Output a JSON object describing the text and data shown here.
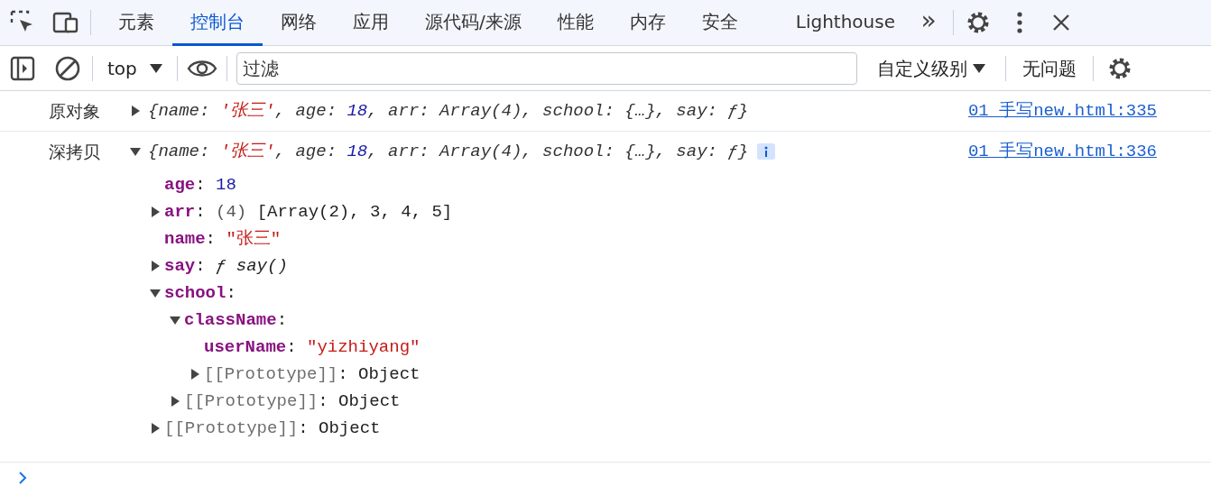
{
  "toolbar": {
    "tabs": [
      {
        "label": "元素",
        "selected": false
      },
      {
        "label": "控制台",
        "selected": true
      },
      {
        "label": "网络",
        "selected": false
      },
      {
        "label": "应用",
        "selected": false
      },
      {
        "label": "源代码/来源",
        "selected": false
      },
      {
        "label": "性能",
        "selected": false
      },
      {
        "label": "内存",
        "selected": false
      },
      {
        "label": "安全",
        "selected": false
      },
      {
        "label": "Lighthouse",
        "selected": false
      }
    ],
    "more": "»"
  },
  "console_bar": {
    "context": "top",
    "filter": {
      "placeholder": "过滤"
    },
    "levels": "自定义级别",
    "issues": "无问题"
  },
  "messages": [
    {
      "label": "原对象",
      "expanded": false,
      "info": false,
      "source": "01_手写new.html:335",
      "preview": [
        {
          "text": "{name: ",
          "kind": "plain"
        },
        {
          "text": "'张三'",
          "kind": "string"
        },
        {
          "text": ", age: ",
          "kind": "plain"
        },
        {
          "text": "18",
          "kind": "number"
        },
        {
          "text": ", arr: Array(4), school: {…}, say: ƒ}",
          "kind": "plain"
        }
      ]
    },
    {
      "label": "深拷贝",
      "expanded": true,
      "info": true,
      "source": "01_手写new.html:336",
      "preview": [
        {
          "text": "{name: ",
          "kind": "plain"
        },
        {
          "text": "'张三'",
          "kind": "string"
        },
        {
          "text": ", age: ",
          "kind": "plain"
        },
        {
          "text": "18",
          "kind": "number"
        },
        {
          "text": ", arr: Array(4), school: {…}, say: ƒ}",
          "kind": "plain"
        }
      ],
      "children": [
        {
          "kind": "leaf",
          "key": "age",
          "value": [
            {
              "text": ":",
              "kind": "punct"
            },
            {
              "text": "18",
              "kind": "number"
            }
          ]
        },
        {
          "kind": "branch",
          "expanded": false,
          "key": "arr",
          "value": [
            {
              "text": ":",
              "kind": "punct"
            },
            {
              "text": "(4)",
              "kind": "meta"
            },
            {
              "text": "[Array(2), 3, 4, 5]",
              "kind": "object"
            }
          ]
        },
        {
          "kind": "leaf",
          "key": "name",
          "value": [
            {
              "text": ":",
              "kind": "punct"
            },
            {
              "text": "\"张三\"",
              "kind": "string"
            }
          ]
        },
        {
          "kind": "branch",
          "expanded": false,
          "key": "say",
          "value": [
            {
              "text": ":",
              "kind": "punct"
            },
            {
              "text": "ƒ say()",
              "kind": "function"
            }
          ]
        },
        {
          "kind": "branch",
          "expanded": true,
          "key": "school",
          "value": [
            {
              "text": ":",
              "kind": "punct"
            }
          ],
          "children": [
            {
              "kind": "branch",
              "expanded": true,
              "key": "className",
              "value": [
                {
                  "text": ":",
                  "kind": "punct"
                }
              ],
              "children": [
                {
                  "kind": "leaf",
                  "key": "userName",
                  "value": [
                    {
                      "text": ":",
                      "kind": "punct"
                    },
                    {
                      "text": "\"yizhiyang\"",
                      "kind": "string"
                    }
                  ]
                },
                {
                  "kind": "internal",
                  "expanded": false,
                  "key": "[[Prototype]]",
                  "value": [
                    {
                      "text": ":",
                      "kind": "punct"
                    },
                    {
                      "text": "Object",
                      "kind": "object"
                    }
                  ]
                }
              ]
            },
            {
              "kind": "internal",
              "expanded": false,
              "key": "[[Prototype]]",
              "value": [
                {
                  "text": ":",
                  "kind": "punct"
                },
                {
                  "text": "Object",
                  "kind": "object"
                }
              ]
            }
          ]
        },
        {
          "kind": "internal",
          "expanded": false,
          "key": "[[Prototype]]",
          "value": [
            {
              "text": ":",
              "kind": "punct"
            },
            {
              "text": "Object",
              "kind": "object"
            }
          ]
        }
      ]
    }
  ]
}
